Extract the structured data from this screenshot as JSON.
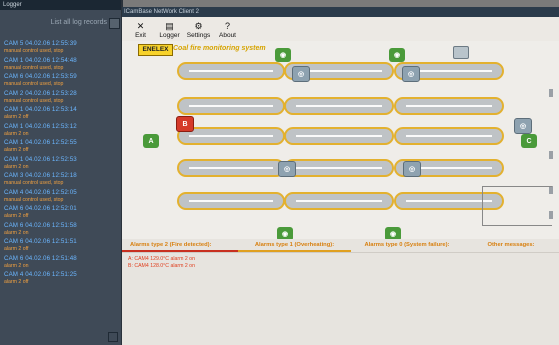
{
  "logger": {
    "title": "Logger",
    "list_all": "List all log records",
    "entries": [
      {
        "time": "CAM 5  04.02.06 12:55:39",
        "desc": "manual control used, stop"
      },
      {
        "time": "CAM 1  04.02.06 12:54:48",
        "desc": "manual control used, stop"
      },
      {
        "time": "CAM 6  04.02.06 12:53:59",
        "desc": "manual control used, stop"
      },
      {
        "time": "CAM 2  04.02.06 12:53:28",
        "desc": "manual control used, stop"
      },
      {
        "time": "CAM 1  04.02.06 12:53:14",
        "desc": "alarm 2 off"
      },
      {
        "time": "CAM 1  04.02.06 12:53:12",
        "desc": "alarm 2 on"
      },
      {
        "time": "CAM 1  04.02.06 12:52:55",
        "desc": "alarm 2 off"
      },
      {
        "time": "CAM 1  04.02.06 12:52:53",
        "desc": "alarm 2 on"
      },
      {
        "time": "CAM 3  04.02.06 12:52:18",
        "desc": "manual control used, stop"
      },
      {
        "time": "CAM 4  04.02.06 12:52:05",
        "desc": "manual control used, stop"
      },
      {
        "time": "CAM 6  04.02.06 12:52:01",
        "desc": "alarm 2 off"
      },
      {
        "time": "CAM 6  04.02.06 12:51:58",
        "desc": "alarm 2 on"
      },
      {
        "time": "CAM 6  04.02.06 12:51:51",
        "desc": "alarm 2 off"
      },
      {
        "time": "CAM 6  04.02.06 12:51:48",
        "desc": "alarm 2 on"
      },
      {
        "time": "CAM 4  04.02.06 12:51:25",
        "desc": "alarm 2 off"
      }
    ]
  },
  "window": {
    "title": "ICamBase NetWork Client 2",
    "toolbar": {
      "exit": "Exit",
      "logger": "Logger",
      "settings": "Settings",
      "about": "About"
    }
  },
  "canvas": {
    "logo": "ENELEX",
    "subtitle": "Coal fire monitoring system",
    "labels": {
      "fire_badge": "B",
      "cam_a": "A",
      "cam_c": "C"
    }
  },
  "alarms": {
    "tabs": [
      "Alarms type 2 (Fire detected):",
      "Alarms type 1 (Overheating):",
      "Alarms type 0 (System failure):",
      "Other messages:"
    ],
    "list": [
      "A: CAM4 129.0°C alarm 2 on",
      "B: CAM4 128.0°C alarm 2 on"
    ]
  },
  "colors": {
    "accent": "#f7d22a",
    "alarm_text": "#e04020",
    "log_time": "#6bb6ff",
    "log_desc": "#f0a040"
  },
  "icons": [
    "exit-icon",
    "logger-icon",
    "settings-icon",
    "about-icon",
    "camera-icon",
    "fire-icon"
  ]
}
